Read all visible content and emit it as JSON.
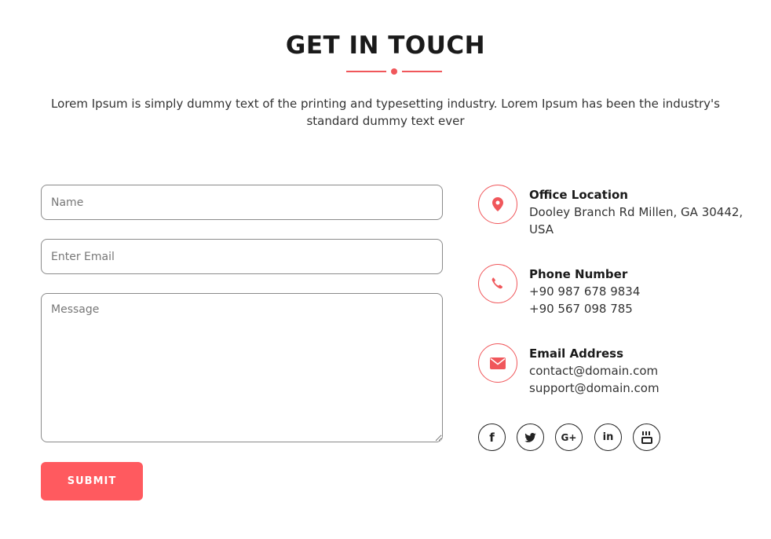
{
  "header": {
    "title": "GET IN TOUCH",
    "subtitle": "Lorem Ipsum is simply dummy text of the printing and typesetting industry. Lorem Ipsum has been the industry's standard dummy text ever"
  },
  "form": {
    "name_placeholder": "Name",
    "email_placeholder": "Enter Email",
    "message_placeholder": "Message",
    "submit_label": "SUBMIT"
  },
  "contact": {
    "location": {
      "heading": "Office Location",
      "line1": "Dooley Branch Rd Millen, GA 30442, USA",
      "icon": "map-pin-icon"
    },
    "phone": {
      "heading": "Phone Number",
      "line1": "+90 987 678 9834",
      "line2": "+90 567 098 785",
      "icon": "phone-icon"
    },
    "email": {
      "heading": "Email Address",
      "line1": "contact@domain.com",
      "line2": "support@domain.com",
      "icon": "envelope-icon"
    }
  },
  "social": {
    "items": [
      {
        "icon": "facebook-icon",
        "glyph": "f"
      },
      {
        "icon": "twitter-icon",
        "glyph": ""
      },
      {
        "icon": "google-plus-icon",
        "glyph": "G+"
      },
      {
        "icon": "linkedin-icon",
        "glyph": "in"
      },
      {
        "icon": "youtube-icon",
        "glyph": ""
      }
    ]
  },
  "colors": {
    "accent": "#ff5a5f",
    "text": "#333333",
    "heading": "#1a1a1a",
    "border": "#8a8a8a"
  }
}
